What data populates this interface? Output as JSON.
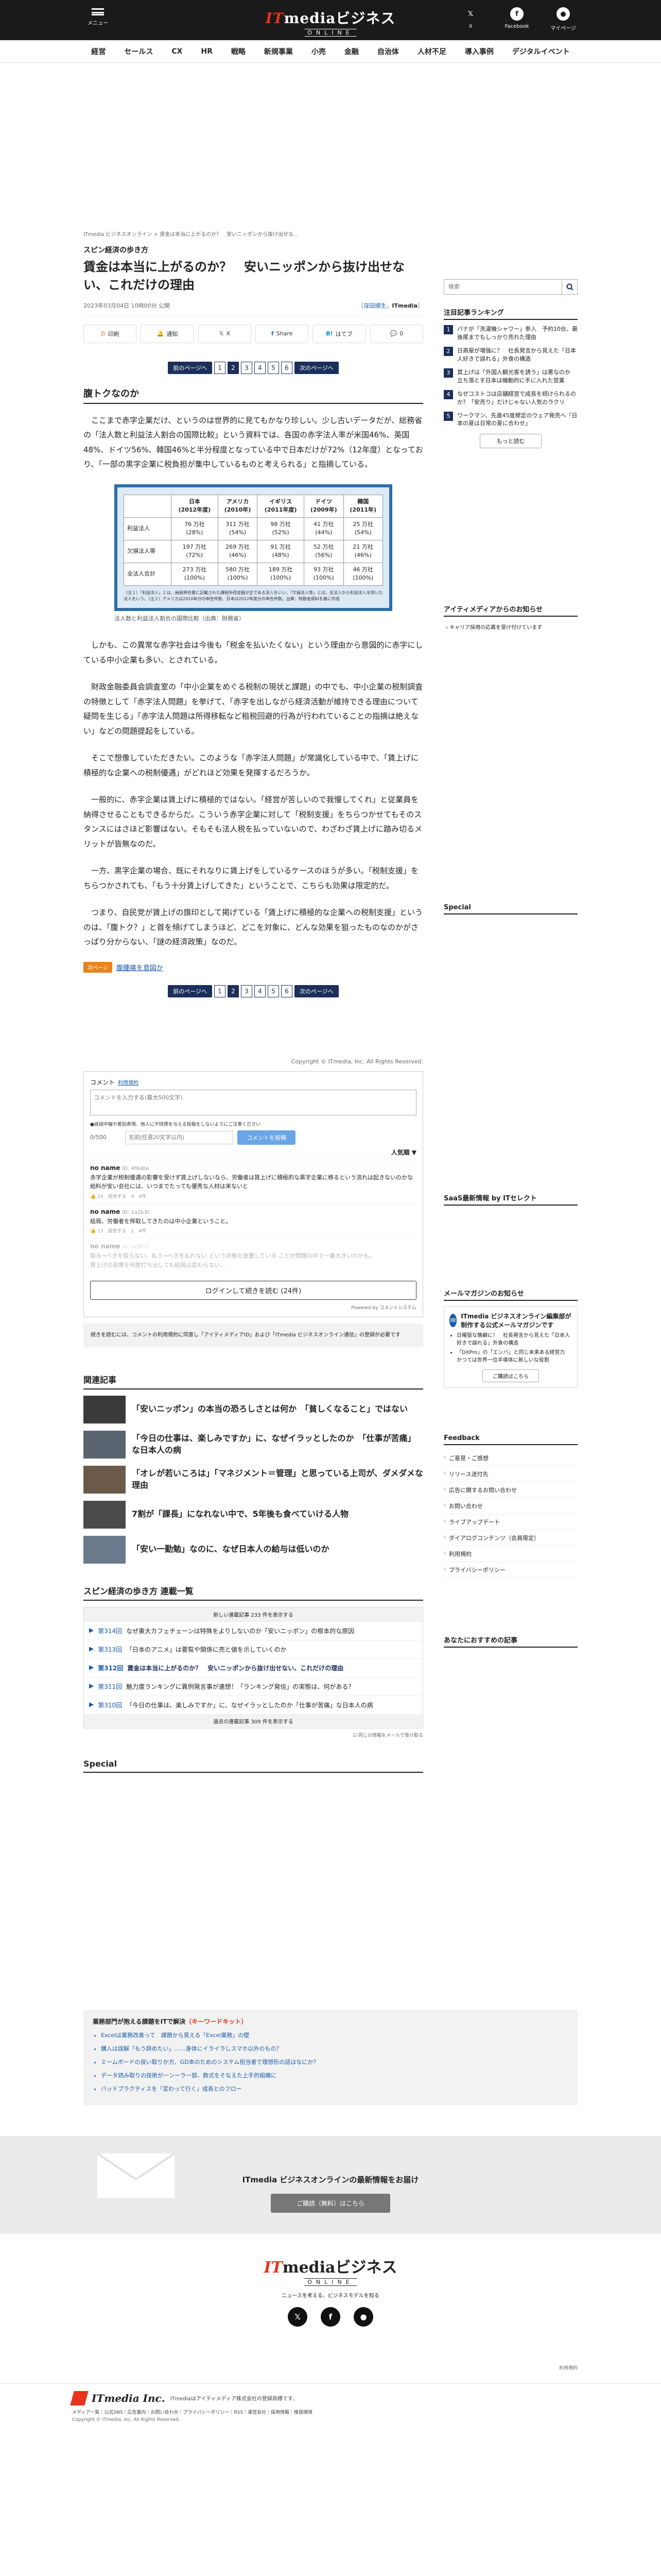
{
  "header": {
    "menu_label": "メニュー",
    "logo_main_prefix": "IT",
    "logo_main_rest": "mediaビジネス",
    "logo_sub": "ONLINE",
    "x_label": "X",
    "facebook_label": "Facebook",
    "mypage_label": "マイページ"
  },
  "nav": [
    "経営",
    "セールス",
    "CX",
    "HR",
    "戦略",
    "新規事業",
    "小売",
    "金融",
    "自治体",
    "人材不足",
    "導入事例",
    "デジタルイベント"
  ],
  "breadcrumb": "ITmedia ビジネスオンライン > 賃金は本当に上がるのか？　安いニッポンから抜け出せな...",
  "article": {
    "series": "スピン経済の歩き方",
    "title": "賃金は本当に上がるのか？　安いニッポンから抜け出せない、これだけの理由",
    "date": "2023年03月04日 10時00分 公開",
    "byline_pre": "［",
    "author": "窪田順生",
    "byline_mid": "，",
    "publisher": "ITmedia",
    "byline_post": "］",
    "share": [
      "印刷",
      "通知",
      "X",
      "Share",
      "はてブ",
      "0"
    ],
    "pager": {
      "prev": "前のページへ",
      "next": "次のページへ",
      "pages": [
        "1",
        "2",
        "3",
        "4",
        "5",
        "6"
      ],
      "current": "2"
    },
    "h2": "腹トクなのか",
    "p1": "　ここまで赤字企業だけ、というのは世界的に見てもかなり珍しい。少し古いデータだが、総務省の「法人数と利益法人割合の国際比較」という資料では、各国の赤字法人率が米国46%、英国48%、ドイツ56%、韓国46%と半分程度となっている中で日本だけが72%（12年度）となっており、「一部の黒字企業に税負担が集中しているものと考えられる」と指摘している。",
    "table": {
      "headers": [
        "",
        "日本\n(2012年度)",
        "アメリカ\n(2010年)",
        "イギリス\n(2011年度)",
        "ドイツ\n(2009年)",
        "韓国\n(2011年)"
      ],
      "rows": [
        {
          "label": "利益法人",
          "cells": [
            "76 万社\n(28%)",
            "311 万社\n(54%)",
            "98 万社\n(52%)",
            "41 万社\n(44%)",
            "25 万社\n(54%)"
          ]
        },
        {
          "label": "欠損法人等",
          "cells": [
            "197 万社\n(72%)",
            "269 万社\n(46%)",
            "91 万社\n(48%)",
            "52 万社\n(56%)",
            "21 万社\n(46%)"
          ]
        },
        {
          "label": "全法人合計",
          "cells": [
            "273 万社\n(100%)",
            "580 万社\n(100%)",
            "189 万社\n(100%)",
            "93 万社\n(100%)",
            "46 万社\n(100%)"
          ]
        }
      ],
      "note": "（注１）「利益法人」とは、納税申告書に記載された課税所得金額が正である法人をいい、「欠損法人等」とは、全法人から利益法人を除いた法人をいう。（注２）アメリカは2010年分の申告件数、日本は2012年度分の申告件数。出典：財務省資料を基に作成"
    },
    "caption": "法人数と利益法人割合の国際比較（出典：財務省）",
    "p2": "　しかも、この異常な赤字社会は今後も「税金を払いたくない」という理由から意図的に赤字にしている中小企業も多い、とされている。",
    "p3": "　財政金融委員会調査室の「中小企業をめぐる税制の現状と課題」の中でも、中小企業の税制調査の特徴として「赤字法人問題」を挙げて、「赤字を出しながら経済活動が維持できる理由について疑問を生じる」「赤字法人問題は所得移転など租税回避的行為が行われていることの指摘は絶えない」などの問題提起をしている。",
    "p4": "　そこで想像していただきたい。このような「赤字法人問題」が常識化している中で、「賃上げに積極的な企業への税制優遇」がどれほど効果を発揮するだろうか。",
    "p5": "　一般的に、赤字企業は賃上げに積極的ではない。「経営が苦しいので我慢してくれ」と従業員を納得させることもできるからだ。こういう赤字企業に対して「税制支援」をちらつかせてもそのスタンスにはさほど影響はない。そもそも法人税を払っていないので、わざわざ賃上げに踏み切るメリットが皆無なのだ。",
    "p6": "　一方、黒字企業の場合、既にそれなりに賃上げをしているケースのほうが多い。「税制支援」をちらつかされても、「もう十分賃上げしてきた」ということで、こちらも効果は限定的だ。",
    "p7": "　つまり、自民党が賃上げの旗印として掲げている「賃上げに積極的な企業への税制支援」というのは、「腹トク？」と首を傾げてしまうほど、どこを対象に、どんな効果を狙ったものなのかがさっぱり分からない、「謎の経済政策」なのだ。",
    "next_tag": "次ページ",
    "next_link": "腹腫瘍を意図か"
  },
  "copyright": "Copyright © ITmedia, Inc. All Rights Reserved.",
  "comments": {
    "header": "コメント",
    "guide_link": "利用規約",
    "placeholder": "コメントを入力する(最大500文字)",
    "rules": "●誹謗中傷や差別表現、他人に不快感を与える投稿をしないようにご注意ください",
    "count": "0/500",
    "name_placeholder": "名前(任意20文字以内)",
    "post": "コメントを投稿",
    "sort": "人気順 ▼",
    "items": [
      {
        "name": "no name",
        "meta": "ID: 4f6d6a",
        "text": "赤字企業が税制優遇の影響を受けず賃上げしないなら、労働者は賃上げに積極的な黒字企業に移るという流れは起きないのかな\n給料が安い会社には、いつまでたっても優秀な人材は来ないと",
        "act": "返信",
        "likes": "24",
        "reactions": "返信する　4",
        "extra": "4件"
      },
      {
        "name": "no name",
        "meta": "ID: 1a2b3c",
        "text": "結局、労働者を搾取してきたのは中小企業ということ。",
        "act": "返信",
        "likes": "13",
        "reactions": "返信する　1",
        "extra": "4件"
      },
      {
        "name": "no name",
        "meta": "ID: 9e8f7d",
        "text": "取る→べきを取らない、払う→べきを払わない という状態を放置している ことが問題の中で一番大きいのかも。\n賃上げの政策を何度打ち出しても結局は変わらない…",
        "act": "",
        "likes": "",
        "reactions": "",
        "extra": ""
      }
    ],
    "login": "ログインして続きを読む (24件)",
    "powered": "Powered by コメントシステム"
  },
  "gray_note": "続きを読むには、コメントの利用規約に同意し「アイティメディアID」および「ITmedia ビジネスオンライン通信」の登録が必要です",
  "related": {
    "header": "関連記事",
    "items": [
      "「安いニッポン」の本当の恐ろしさとは何か　「貧しくなること」ではない",
      "「今日の仕事は、楽しみですか」に、なぜイラッとしたのか　「仕事が苦痛」な日本人の病",
      "「オレが若いころは」「マネジメント＝管理」と思っている上司が、ダメダメな理由",
      "7割が「課長」になれない中で、5年後も食べていける人物",
      "「安い一勤勉」なのに、なぜ日本人の給与は低いのか"
    ]
  },
  "series_list": {
    "header": "スピン経済の歩き方 連載一覧",
    "newer": "新しい連載記事 233 件を表示する",
    "items": [
      {
        "n": "第314回",
        "t": "なぜ東大カフェチェーンは特殊をよりしないのか「安いニッポン」の根本的な原因"
      },
      {
        "n": "第313回",
        "t": "「日本のアニメ」は要覧や関係に売と値を示していくのか"
      },
      {
        "n": "第312回",
        "t": "賃金は本当に上がるのか？　安いニッポンから抜け出せない、これだけの理由",
        "cur": true
      },
      {
        "n": "第311回",
        "t": "魅力度ランキングに異例発言事が連想！「ランキング発信」の実態は、何がある？"
      },
      {
        "n": "第310回",
        "t": "「今日の仕事は、楽しみですか」に、なぜイラッとしたのか「仕事が苦痛」な日本人の病"
      }
    ],
    "older": "過去の連載記事 309 件を表示する",
    "mail": "☑ 同じの情報をメールで受け取る"
  },
  "special_header": "Special",
  "sidebar": {
    "search_placeholder": "検索",
    "ranking_header": "注目記事ランキング",
    "ranking": [
      "パナが「洗濯機シャワー」参入　予約10台、最後尾までもしっかり売れた理由",
      "日高屋が増強に？　社長発言から見えた「日本人好きで誤れる」外食の構造",
      "賞上げは「外国人観光客を誘う」は悪なのか　立ち落とす日本は機動的に手に入れた営業",
      "なぜコストコは店舗経営で成長を続けられるのか？「安売り」だけじゃない人気のラクリ",
      "ワークマン、先進45度標定のウェア発売へ「日本の夏は日常の夏に合わせ」"
    ],
    "more": "もっと読む",
    "notice_header": "アイティメディアからのお知らせ",
    "notice_item": "キャリア採用の応募を受け付けています",
    "special_header": "Special",
    "saas_header": "SaaS最新情報 by ITセレクト",
    "mail_header": "メールマガジンのお知らせ",
    "mail_title": "ITmedia ビジネスオンライン編集部が制作する公式メールマガジンです",
    "mail_items": [
      "日曜版な懐顧に！　社長発言から見えた「日本人好きで誤れる」外食の構造",
      "「DXPro」の「エンバ」と同じ未来ある経営力　かつては世界一位半導体に新しいな役割"
    ],
    "mail_btn": "ご購読はこちら",
    "feedback_header": "Feedback",
    "feedback": [
      "ご意見・ご感想",
      "リリース送付先",
      "広告に関するお問い合わせ",
      "お問い合わせ",
      "ライブアップデート",
      "ダイアログコンテンツ（会員限定）",
      "利用規約",
      "プライバシーポリシー"
    ],
    "recommend_header": "あなたにおすすめの記事"
  },
  "jobs": {
    "header_pre": "業務部門が抱える課題をITで解決",
    "header_tag": "（キーワードキット）",
    "items": [
      "Excelは業務改善って　課題から見える「Excel業務」の壁",
      "購入は誤解「もう辞めたい」……身体にイライラしスマホ以外のもの？",
      "ミームボードの良い取りか方、GD本のためのシステム担当者で理想形の話はなにか？",
      "データ読み取りの技術が一ンーラ一部、数式をそなえた上手的組織に",
      "バッドプラクティスを「変わって行く」成長とのフロー"
    ]
  },
  "mailband": {
    "title": "ITmedia ビジネスオンラインの最新情報をお届け",
    "button": "ご購読（無料）はこちら"
  },
  "footer": {
    "logo_prefix": "IT",
    "logo_rest": "mediaビジネス",
    "logo_sub": "ONLINE",
    "tagline": "ニュースを考える、ビジネスモデルを知る",
    "tos": "利用規約"
  },
  "corp": {
    "name": "ITmedia Inc.",
    "desc": "ITmediaはアイティメディア株式会社の登録商標です。",
    "links": "メディア一覧｜公式SNS｜広告案内｜お問い合わせ｜プライバシーポリシー｜RSS｜運営会社｜採用情報｜推奨環境",
    "copy": "Copyright © ITmedia, Inc. All Rights Reserved."
  }
}
